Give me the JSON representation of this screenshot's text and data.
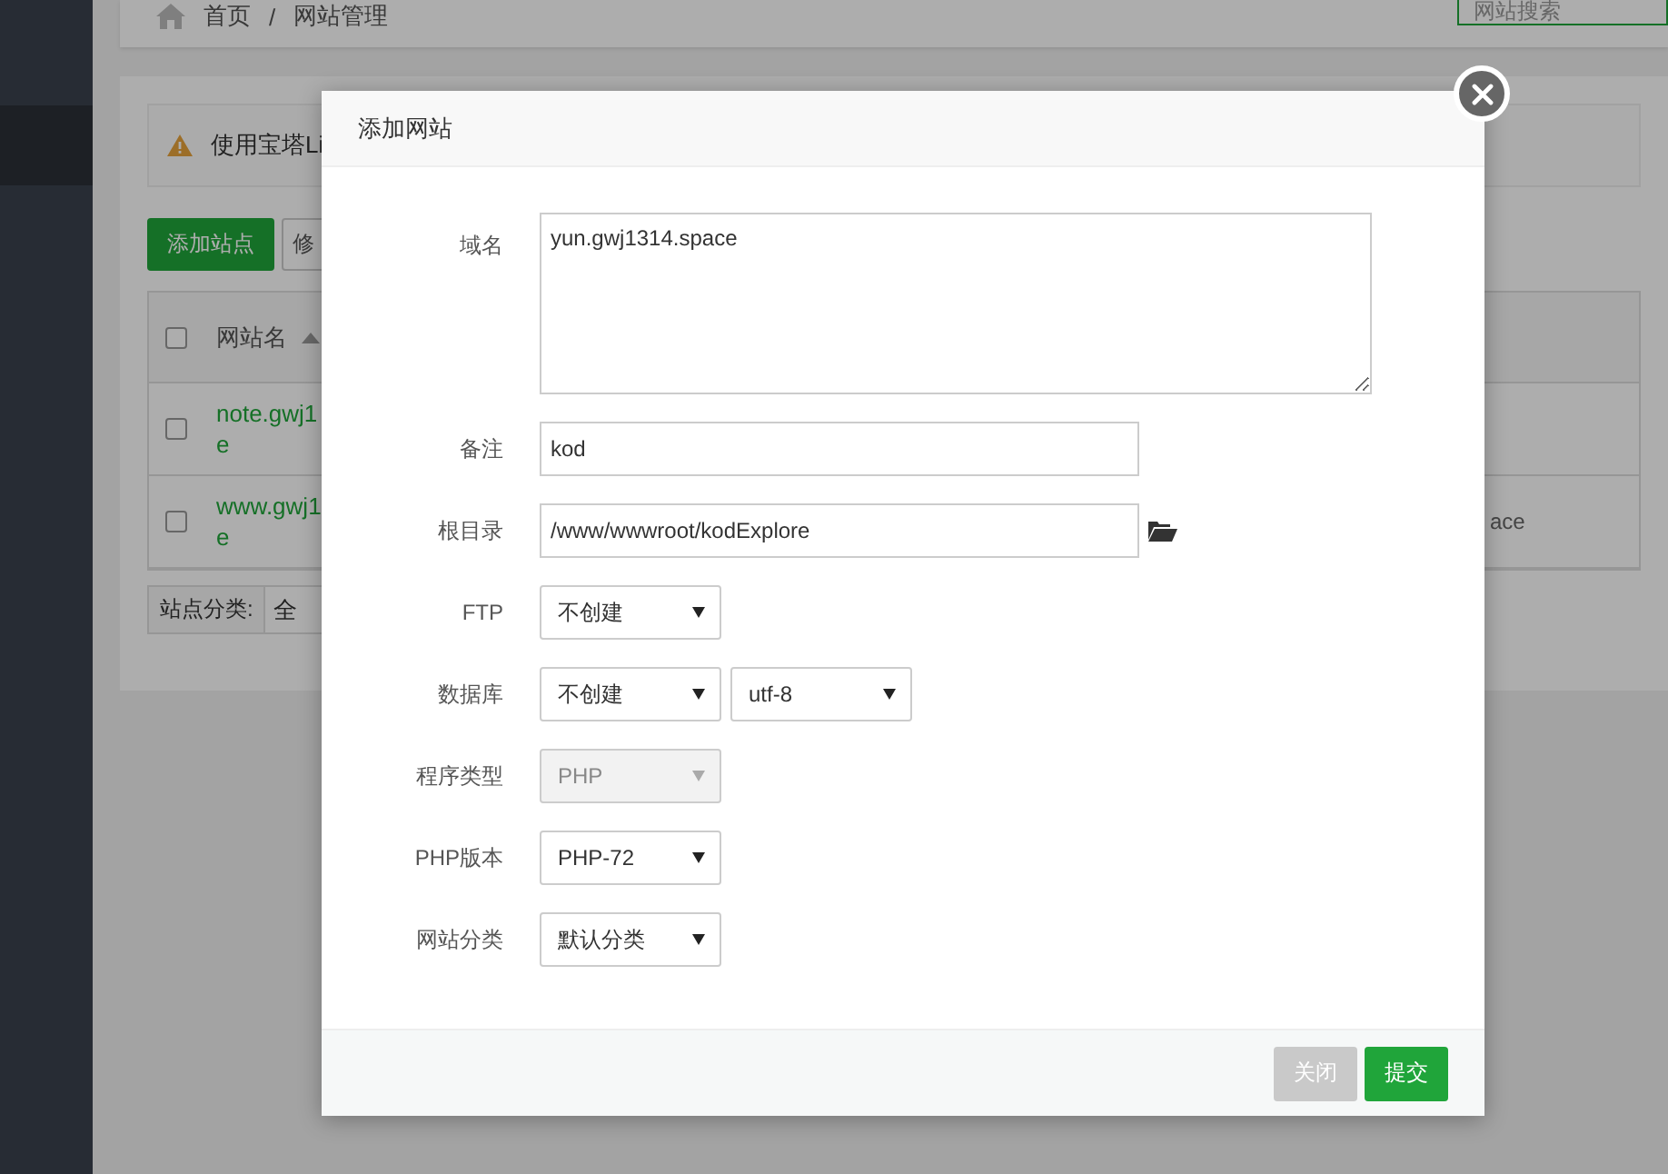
{
  "page": {
    "breadcrumb": {
      "home": "首页",
      "separator": "/",
      "current": "网站管理"
    },
    "search": {
      "placeholder": "网站搜索"
    },
    "notice": "使用宝塔Li",
    "toolbar": [
      {
        "label": "添加站点",
        "primary": true
      },
      {
        "label": "修",
        "primary": false
      }
    ],
    "table": {
      "header": {
        "checked": false,
        "label": "网站名"
      },
      "rows": [
        {
          "checked": false,
          "name_lines": [
            "note.gwj1",
            "e"
          ]
        },
        {
          "checked": false,
          "name_lines": [
            "www.gwj1",
            "e"
          ],
          "column_2": "ace"
        }
      ]
    },
    "category": {
      "label": "站点分类:",
      "value": "全"
    }
  },
  "dialog": {
    "title": "添加网站",
    "fields": [
      {
        "kind": "textarea",
        "label": "域名",
        "value": "yun.gwj1314.space"
      },
      {
        "kind": "text",
        "label": "备注",
        "value": "kod"
      },
      {
        "kind": "path",
        "label": "根目录",
        "value": "/www/wwwroot/kodExplore"
      },
      {
        "kind": "select",
        "label": "FTP",
        "selects": [
          {
            "value": "不创建",
            "disabled": false
          }
        ]
      },
      {
        "kind": "select",
        "label": "数据库",
        "selects": [
          {
            "value": "不创建",
            "disabled": false
          },
          {
            "value": "utf-8",
            "disabled": false
          }
        ]
      },
      {
        "kind": "select",
        "label": "程序类型",
        "selects": [
          {
            "value": "PHP",
            "disabled": true
          }
        ]
      },
      {
        "kind": "select",
        "label": "PHP版本",
        "selects": [
          {
            "value": "PHP-72",
            "disabled": false
          }
        ]
      },
      {
        "kind": "select",
        "label": "网站分类",
        "selects": [
          {
            "value": "默认分类",
            "disabled": false
          }
        ]
      }
    ],
    "buttons": [
      {
        "label": "关闭",
        "primary": false
      },
      {
        "label": "提交",
        "primary": true
      }
    ]
  }
}
